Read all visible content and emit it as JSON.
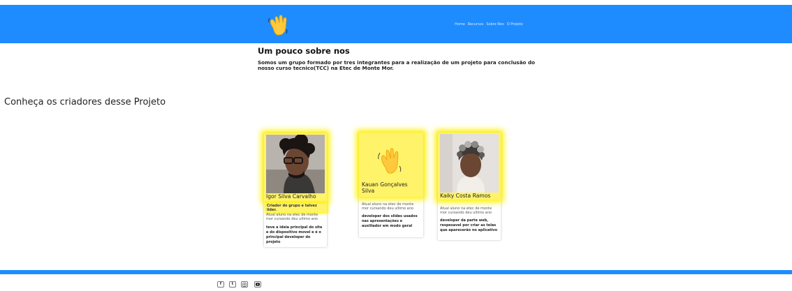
{
  "header": {
    "logo": "waving-hand-icon",
    "nav": [
      "Home",
      "Recursos",
      "Sobre Nos",
      "O Projeto"
    ],
    "bg_color": "#1e8cff"
  },
  "about": {
    "title": "Um pouco sobre nos",
    "text": "Somos um grupo formado por tres integrantes para a realização de um projeto para conclusão do nosso curso tecnico(TCC) na Etec de Monte Mor."
  },
  "creators_title": "Conheça os criadores desse Projeto",
  "cards": [
    {
      "name": "Igor Silva Carvalho",
      "role": "Criador do grupo e talvez lider.",
      "desc": "Atual aluno na etec de monte mor cursando deu ultimo ano",
      "task": "teve a ideia principal do site e do dispositivo movel e é o principal developer do projeto"
    },
    {
      "name": "Kauan Gonçalves Silva",
      "desc": "Atual aluno na etec de monte mor cursando deu ultimo ano",
      "task": "developer dos slides usados nas apresentações e auxiliador em modo geral"
    },
    {
      "name": "Kaiky Costa Ramos",
      "desc": "Atual aluno na etec de monte mor cursando deu ultimo ano",
      "task": "developer da parte web, respesavel por criar as telas que aparecerão no aplicativo"
    }
  ],
  "footer": {
    "social": [
      "facebook-icon",
      "twitter-icon",
      "instagram-icon",
      "youtube-icon"
    ]
  },
  "highlight_color": "#fff100"
}
